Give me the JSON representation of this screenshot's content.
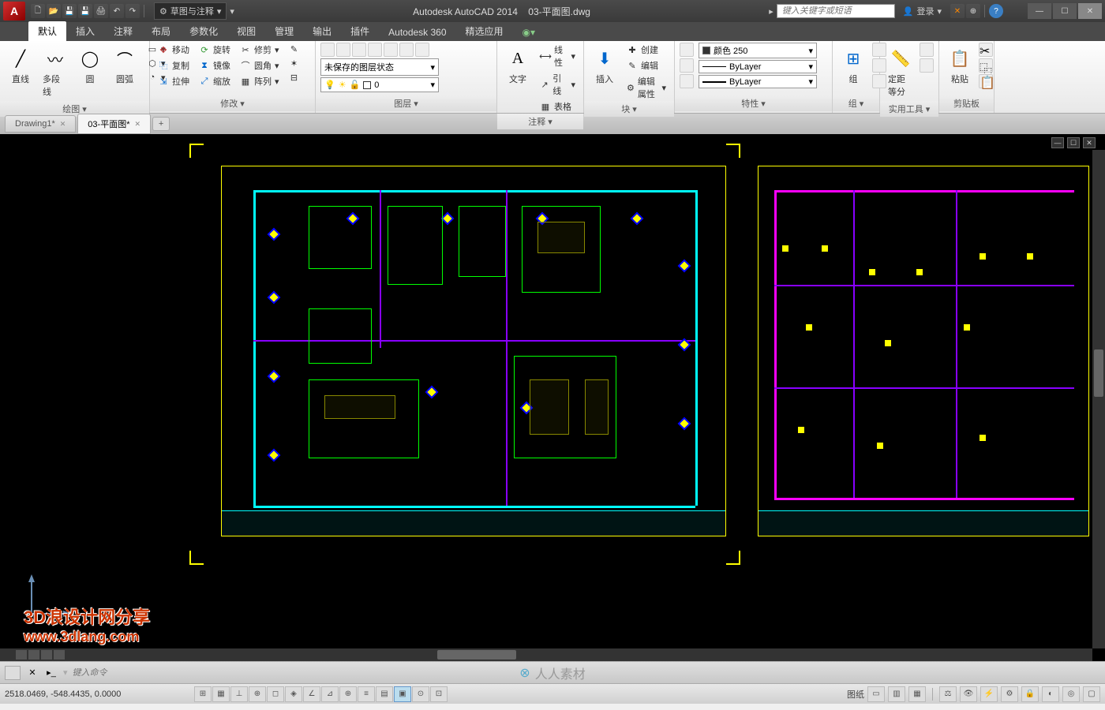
{
  "app": {
    "title": "Autodesk AutoCAD 2014",
    "file": "03-平面图.dwg"
  },
  "qat": {
    "workspace": "草图与注释",
    "search_ph": "键入关键字或短语",
    "login": "登录"
  },
  "ribbon_tabs": [
    "默认",
    "插入",
    "注释",
    "布局",
    "参数化",
    "视图",
    "管理",
    "输出",
    "插件",
    "Autodesk 360",
    "精选应用"
  ],
  "panels": {
    "draw": {
      "label": "绘图 ▾",
      "line": "直线",
      "pline": "多段线",
      "circle": "圆",
      "arc": "圆弧"
    },
    "modify": {
      "label": "修改 ▾",
      "move": "移动",
      "rotate": "旋转",
      "trim": "修剪",
      "copy": "复制",
      "mirror": "镜像",
      "fillet": "圆角",
      "stretch": "拉伸",
      "scale": "缩放",
      "array": "阵列"
    },
    "layers": {
      "label": "图层 ▾",
      "state": "未保存的图层状态",
      "current": "0"
    },
    "annot": {
      "label": "注释 ▾",
      "text": "文字",
      "linear": "线性",
      "leader": "引线",
      "table": "表格"
    },
    "block": {
      "label": "块 ▾",
      "insert": "插入",
      "create": "创建",
      "edit": "编辑",
      "editattr": "编辑属性"
    },
    "props": {
      "label": "特性 ▾",
      "color": "颜色 250",
      "lt": "ByLayer",
      "lw": "ByLayer"
    },
    "groups": {
      "label": "组 ▾",
      "group": "组"
    },
    "util": {
      "label": "实用工具 ▾",
      "measure": "定距等分"
    },
    "clip": {
      "label": "剪贴板",
      "paste": "粘贴"
    }
  },
  "doc_tabs": [
    {
      "name": "Drawing1*",
      "active": false
    },
    {
      "name": "03-平面图*",
      "active": true
    }
  ],
  "cmd": {
    "placeholder": "键入命令"
  },
  "status": {
    "coords": "2518.0469, -548.4435, 0.0000",
    "paper_label": "图纸"
  },
  "watermark": {
    "l1": "3D浪设计网分享",
    "l2": "www.3dlang.com"
  },
  "center_brand": "人人素材"
}
